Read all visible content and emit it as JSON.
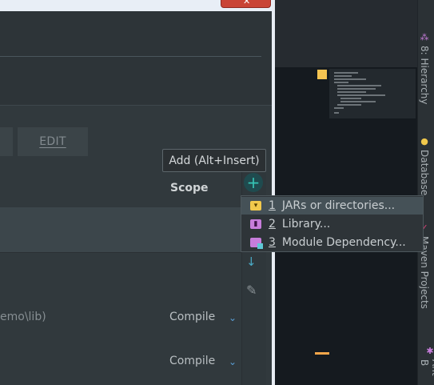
{
  "dialog": {
    "close_glyph": "✕",
    "edit_label": "EDIT",
    "tooltip": "Add (Alt+Insert)",
    "scope_header": "Scope",
    "add_glyph": "+",
    "down_glyph": "↓",
    "pencil_glyph": "✎",
    "rows": [
      {
        "path": "emo\\lib)",
        "scope": "Compile"
      },
      {
        "path": "",
        "scope": "Compile"
      }
    ],
    "chevron_glyph": "⌄"
  },
  "popup_menu": {
    "items": [
      {
        "number": "1",
        "label": "JARs or directories...",
        "icon": "jar-folder-icon",
        "selected": true
      },
      {
        "number": "2",
        "label": "Library...",
        "icon": "library-icon",
        "selected": false
      },
      {
        "number": "3",
        "label": "Module Dependency...",
        "icon": "module-icon",
        "selected": false
      }
    ]
  },
  "right_stripe": {
    "tabs": [
      {
        "label": "8: Hierarchy",
        "icon": "hierarchy-icon"
      },
      {
        "label": "Database",
        "icon": "database-icon"
      },
      {
        "label": "Maven Projects",
        "icon": "maven-icon"
      },
      {
        "label": "Ant B",
        "icon": "ant-icon"
      }
    ]
  },
  "colors": {
    "accent_add": "#36c5b6",
    "close_red": "#c94436",
    "marker_yellow": "#f5c451",
    "marker_orange": "#f5a64a"
  }
}
